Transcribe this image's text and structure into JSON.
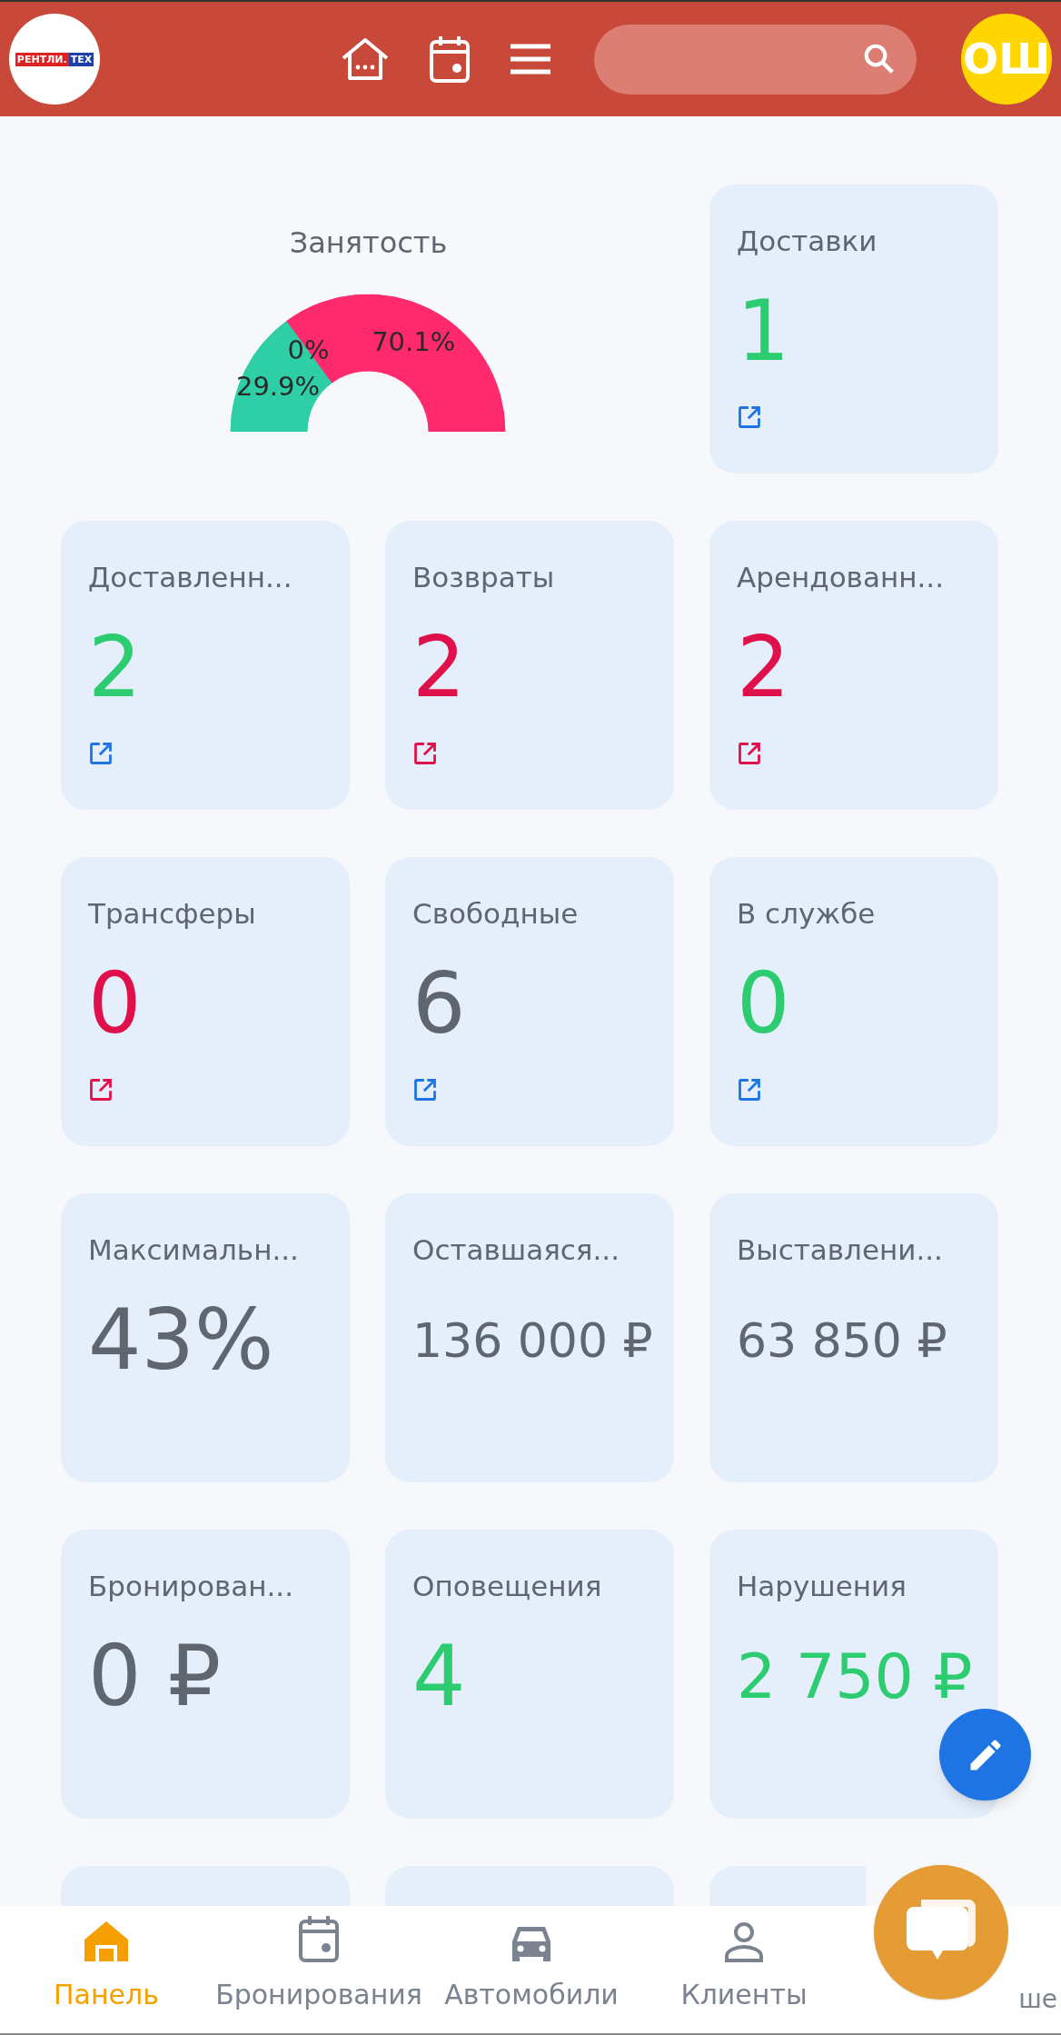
{
  "header": {
    "logo": {
      "left": "РЕНТЛИ.",
      "right": "ТЕХ"
    },
    "avatar": "ОШ"
  },
  "occupancy": {
    "title": "Занятость",
    "chart_data": {
      "type": "donut",
      "values": [
        29.9,
        0,
        70.1
      ],
      "colors": [
        "#2ecfa6",
        "#2ecfa6",
        "#ff2a6d"
      ],
      "value_labels": [
        "29.9%",
        "0%",
        "70.1%"
      ]
    }
  },
  "cards": [
    {
      "title": "Доставки",
      "value": "1",
      "color": "#2ecc71",
      "link": {
        "color": "#1f74e3"
      }
    },
    {
      "title": "Доставленн...",
      "value": "2",
      "color": "#2ecc71",
      "link": {
        "color": "#1f74e3"
      }
    },
    {
      "title": "Возвраты",
      "value": "2",
      "color": "#e0114a",
      "link": {
        "color": "#e0114a"
      }
    },
    {
      "title": "Арендованн...",
      "value": "2",
      "color": "#e0114a",
      "link": {
        "color": "#e0114a"
      }
    },
    {
      "title": "Трансферы",
      "value": "0",
      "color": "#e0114a",
      "link": {
        "color": "#e0114a"
      }
    },
    {
      "title": "Свободные",
      "value": "6",
      "color": "#5f6670",
      "link": {
        "color": "#1f74e3"
      }
    },
    {
      "title": "В службе",
      "value": "0",
      "color": "#2ecc71",
      "link": {
        "color": "#1f74e3"
      }
    },
    {
      "title": "Максимальн...",
      "value": "43%",
      "color": "#5f6670"
    },
    {
      "title": "Оставшаяся...",
      "value": "136 000 ₽",
      "color": "#5f6670"
    },
    {
      "title": "Выставлени...",
      "value": "63 850 ₽",
      "color": "#5f6670"
    },
    {
      "title": "Бронирован...",
      "value": "0 ₽",
      "color": "#5f6670"
    },
    {
      "title": "Оповещения",
      "value": "4",
      "color": "#2ecc71"
    },
    {
      "title": "Нарушения",
      "value": "2 750 ₽",
      "color": "#2ecc71"
    }
  ],
  "bottom_nav": [
    {
      "label": "Панель",
      "selected": true
    },
    {
      "label": "Бронирования",
      "selected": false
    },
    {
      "label": "Автомобили",
      "selected": false
    },
    {
      "label": "Клиенты",
      "selected": false
    },
    {
      "label": "ше",
      "selected": false
    }
  ]
}
